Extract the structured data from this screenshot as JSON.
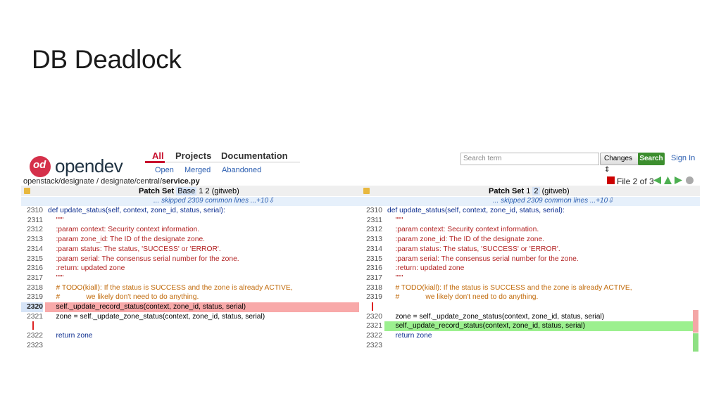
{
  "slide_title": "DB Deadlock",
  "header": {
    "brand": "opendev",
    "menu": [
      {
        "label": "All",
        "active": true
      },
      {
        "label": "Projects",
        "active": false
      },
      {
        "label": "Documentation",
        "active": false
      }
    ],
    "submenu": [
      "Open",
      "Merged",
      "Abandoned"
    ],
    "search_placeholder": "Search term",
    "changes_select": "Changes",
    "search_button": "Search",
    "sign_in": "Sign In",
    "accent": "#c8102e"
  },
  "breadcrumb": {
    "path": "openstack/designate / designate/central/",
    "file": "service.py"
  },
  "file_nav": "File 2 of 3",
  "patch_set": {
    "label": "Patch Set",
    "left_base": "Base",
    "left_nums": "1  2",
    "right_prefix": "1",
    "right_selected": "2",
    "gitweb": "(gitweb)"
  },
  "skipped": "... skipped 2309 common lines ...+10⇩",
  "left_lines": [
    {
      "n": "2310",
      "code": "def update_status(self, context, zone_id, status, serial):"
    },
    {
      "n": "2311",
      "code": "    \"\"\""
    },
    {
      "n": "2312",
      "code": "    :param context: Security context information."
    },
    {
      "n": "2313",
      "code": "    :param zone_id: The ID of the designate zone."
    },
    {
      "n": "2314",
      "code": "    :param status: The status, 'SUCCESS' or 'ERROR'."
    },
    {
      "n": "2315",
      "code": "    :param serial: The consensus serial number for the zone."
    },
    {
      "n": "2316",
      "code": "    :return: updated zone"
    },
    {
      "n": "2317",
      "code": "    \"\"\""
    },
    {
      "n": "2318",
      "code": "    # TODO(kiall): If the status is SUCCESS and the zone is already ACTIVE,"
    },
    {
      "n": "2319",
      "code": "    #             we likely don't need to do anything."
    },
    {
      "n": "2320",
      "code": "    self._update_record_status(context, zone_id, status, serial)"
    },
    {
      "n": "2321",
      "code": "    zone = self._update_zone_status(context, zone_id, status, serial)"
    },
    {
      "n": "",
      "code": ""
    },
    {
      "n": "2322",
      "code": "    return zone"
    },
    {
      "n": "2323",
      "code": ""
    }
  ],
  "right_lines": [
    {
      "n": "2310",
      "code": "def update_status(self, context, zone_id, status, serial):"
    },
    {
      "n": "2311",
      "code": "    \"\"\""
    },
    {
      "n": "2312",
      "code": "    :param context: Security context information."
    },
    {
      "n": "2313",
      "code": "    :param zone_id: The ID of the designate zone."
    },
    {
      "n": "2314",
      "code": "    :param status: The status, 'SUCCESS' or 'ERROR'."
    },
    {
      "n": "2315",
      "code": "    :param serial: The consensus serial number for the zone."
    },
    {
      "n": "2316",
      "code": "    :return: updated zone"
    },
    {
      "n": "2317",
      "code": "    \"\"\""
    },
    {
      "n": "2318",
      "code": "    # TODO(kiall): If the status is SUCCESS and the zone is already ACTIVE,"
    },
    {
      "n": "2319",
      "code": "    #             we likely don't need to do anything."
    },
    {
      "n": "",
      "code": ""
    },
    {
      "n": "2320",
      "code": "    zone = self._update_zone_status(context, zone_id, status, serial)"
    },
    {
      "n": "2321",
      "code": "    self._update_record_status(context, zone_id, status, serial)"
    },
    {
      "n": "2322",
      "code": "    return zone"
    },
    {
      "n": "2323",
      "code": ""
    }
  ]
}
